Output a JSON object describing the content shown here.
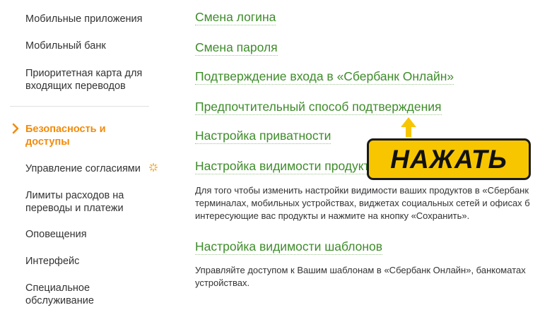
{
  "sidebar": {
    "items": [
      {
        "label": "Мобильные приложения"
      },
      {
        "label": "Мобильный банк"
      },
      {
        "label": "Приоритетная карта для входящих переводов"
      },
      {
        "label": "Безопасность и доступы",
        "active": true
      },
      {
        "label": "Управление согласиями"
      },
      {
        "label": "Лимиты расходов на переводы и платежи"
      },
      {
        "label": "Оповещения"
      },
      {
        "label": "Интерфейс"
      },
      {
        "label": "Специальное обслуживание"
      }
    ],
    "active_color": "#f18b0c"
  },
  "main": {
    "links": [
      {
        "label": "Смена логина"
      },
      {
        "label": "Смена пароля"
      },
      {
        "label": "Подтверждение входа в «Сбербанк Онлайн»"
      },
      {
        "label": "Предпочтительный способ подтверждения"
      },
      {
        "label": "Настройка приватности"
      },
      {
        "label": "Настройка видимости продуктов"
      },
      {
        "label": "Настройка видимости шаблонов"
      }
    ],
    "products_desc": "Для того чтобы изменить настройки видимости ваших продуктов в «Сбербанк\nтерминалах, мобильных устройствах, виджетах социальных сетей и офисах б\nинтересующие вас продукты и нажмите на кнопку «Сохранить».",
    "templates_desc": "Управляйте доступом к Вашим шаблонам в «Сбербанк Онлайн», банкоматах\nустройствах.",
    "link_color": "#3e8c2a"
  },
  "callout": {
    "label": "НАЖАТЬ",
    "color": "#f7c600"
  },
  "icons": {
    "active_marker": "chevron-right-icon",
    "consents_marker": "spinner-icon"
  }
}
